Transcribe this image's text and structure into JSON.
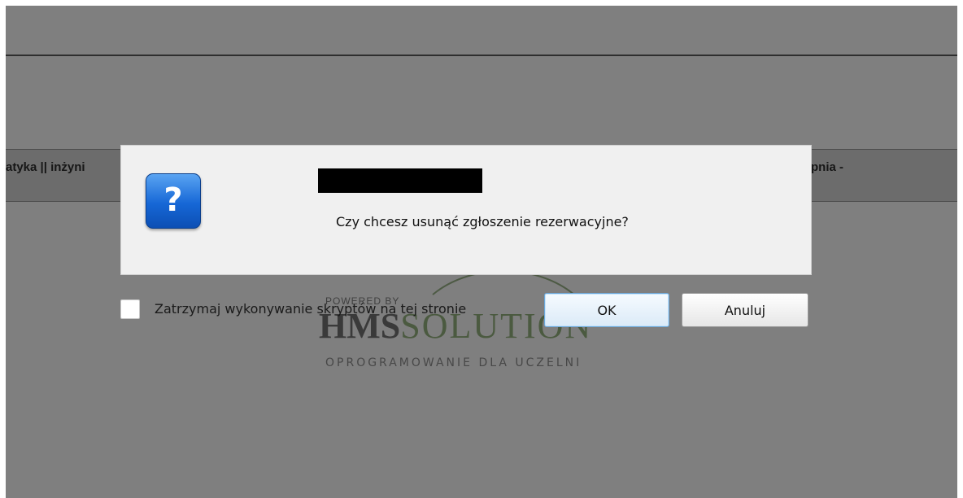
{
  "background": {
    "band_left_text": "atyka || inżyni",
    "band_right_text": "pnia -",
    "logo": {
      "powered": "POWERED BY",
      "brand_bold": "HMS",
      "brand_light": "SOLUTION",
      "tagline": "OPROGRAMOWANIE DLA UCZELNI"
    }
  },
  "dialog": {
    "icon": "question-icon",
    "icon_glyph": "?",
    "message": "Czy chcesz usunąć zgłoszenie rezerwacyjne?",
    "stop_scripts_label": "Zatrzymaj wykonywanie skryptów na tej stronie",
    "ok_label": "OK",
    "cancel_label": "Anuluj"
  },
  "colors": {
    "overlay": "#7f7f7f",
    "dialog_bg": "#f0f0f0",
    "icon_blue": "#1667d6"
  }
}
